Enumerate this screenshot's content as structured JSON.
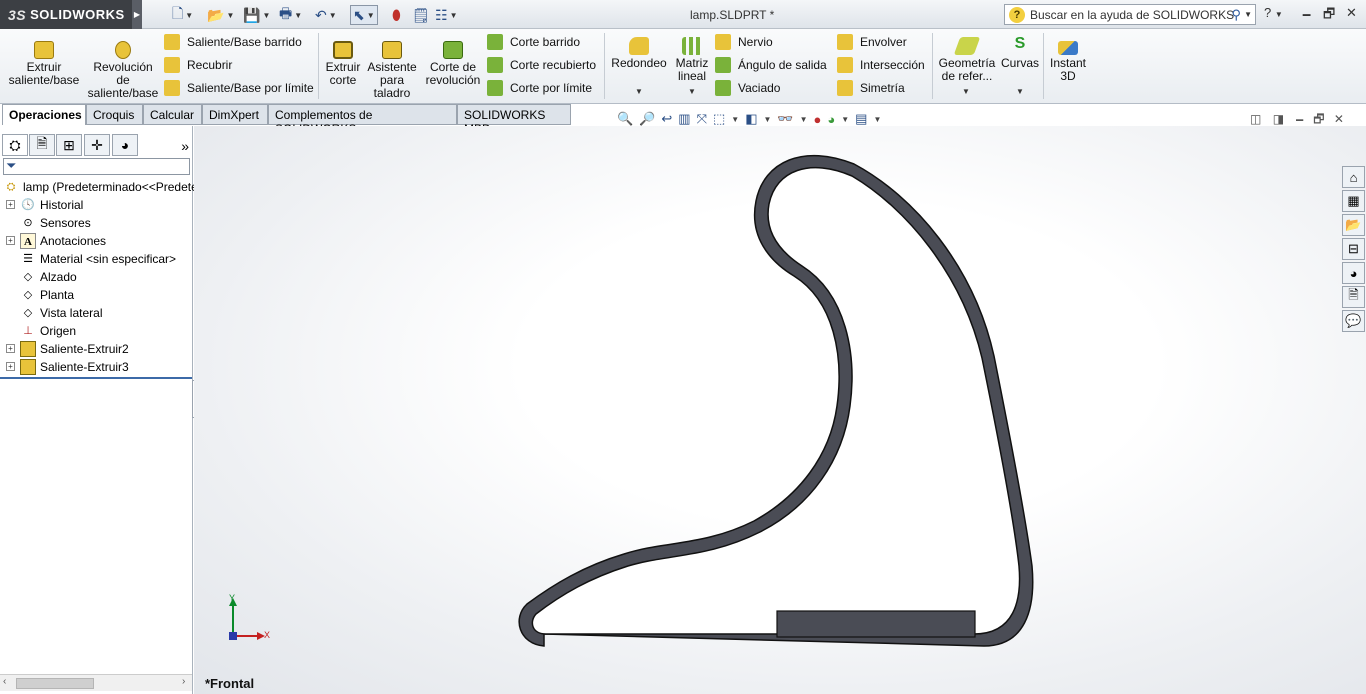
{
  "app": {
    "brand": "SOLIDWORKS",
    "brand_prefix": "3S",
    "doc_title": "lamp.SLDPRT *"
  },
  "help": {
    "search_placeholder": "Buscar en la ayuda de SOLIDWORKS",
    "help_icon": "?"
  },
  "ribbon": {
    "extrude": "Extruir saliente/base",
    "revolve": "Revolución de saliente/base",
    "swept_boss": "Saliente/Base barrido",
    "wrap_edge": "Recubrir",
    "boundary_boss": "Saliente/Base por límite",
    "extrude_cut": "Extruir corte",
    "hole_wizard": "Asistente para taladro",
    "revolve_cut": "Corte de revolución",
    "swept_cut": "Corte barrido",
    "lofted_cut": "Corte recubierto",
    "boundary_cut": "Corte por límite",
    "fillet": "Redondeo",
    "linear_pattern": "Matriz lineal",
    "rib": "Nervio",
    "draft": "Ángulo de salida",
    "shell": "Vaciado",
    "wrap": "Envolver",
    "intersect": "Intersección",
    "mirror": "Simetría",
    "ref_geometry": "Geometría de refer...",
    "curves": "Curvas",
    "instant3d": "Instant 3D"
  },
  "tabs": [
    "Operaciones",
    "Croquis",
    "Calcular",
    "DimXpert",
    "Complementos de SOLIDWORKS",
    "SOLIDWORKS MBD"
  ],
  "tree": {
    "root": "lamp  (Predeterminado<<Predeterminado>",
    "items": [
      "Historial",
      "Sensores",
      "Anotaciones",
      "Material <sin especificar>",
      "Alzado",
      "Planta",
      "Vista lateral",
      "Origen",
      "Saliente-Extruir2",
      "Saliente-Extruir3"
    ]
  },
  "viewport": {
    "view_name": "*Frontal",
    "axis_x": "X",
    "axis_y": "Y"
  },
  "colors": {
    "model_fill": "#4a4c55",
    "accent": "#2b4f86",
    "selection": "#3c6aa8"
  }
}
